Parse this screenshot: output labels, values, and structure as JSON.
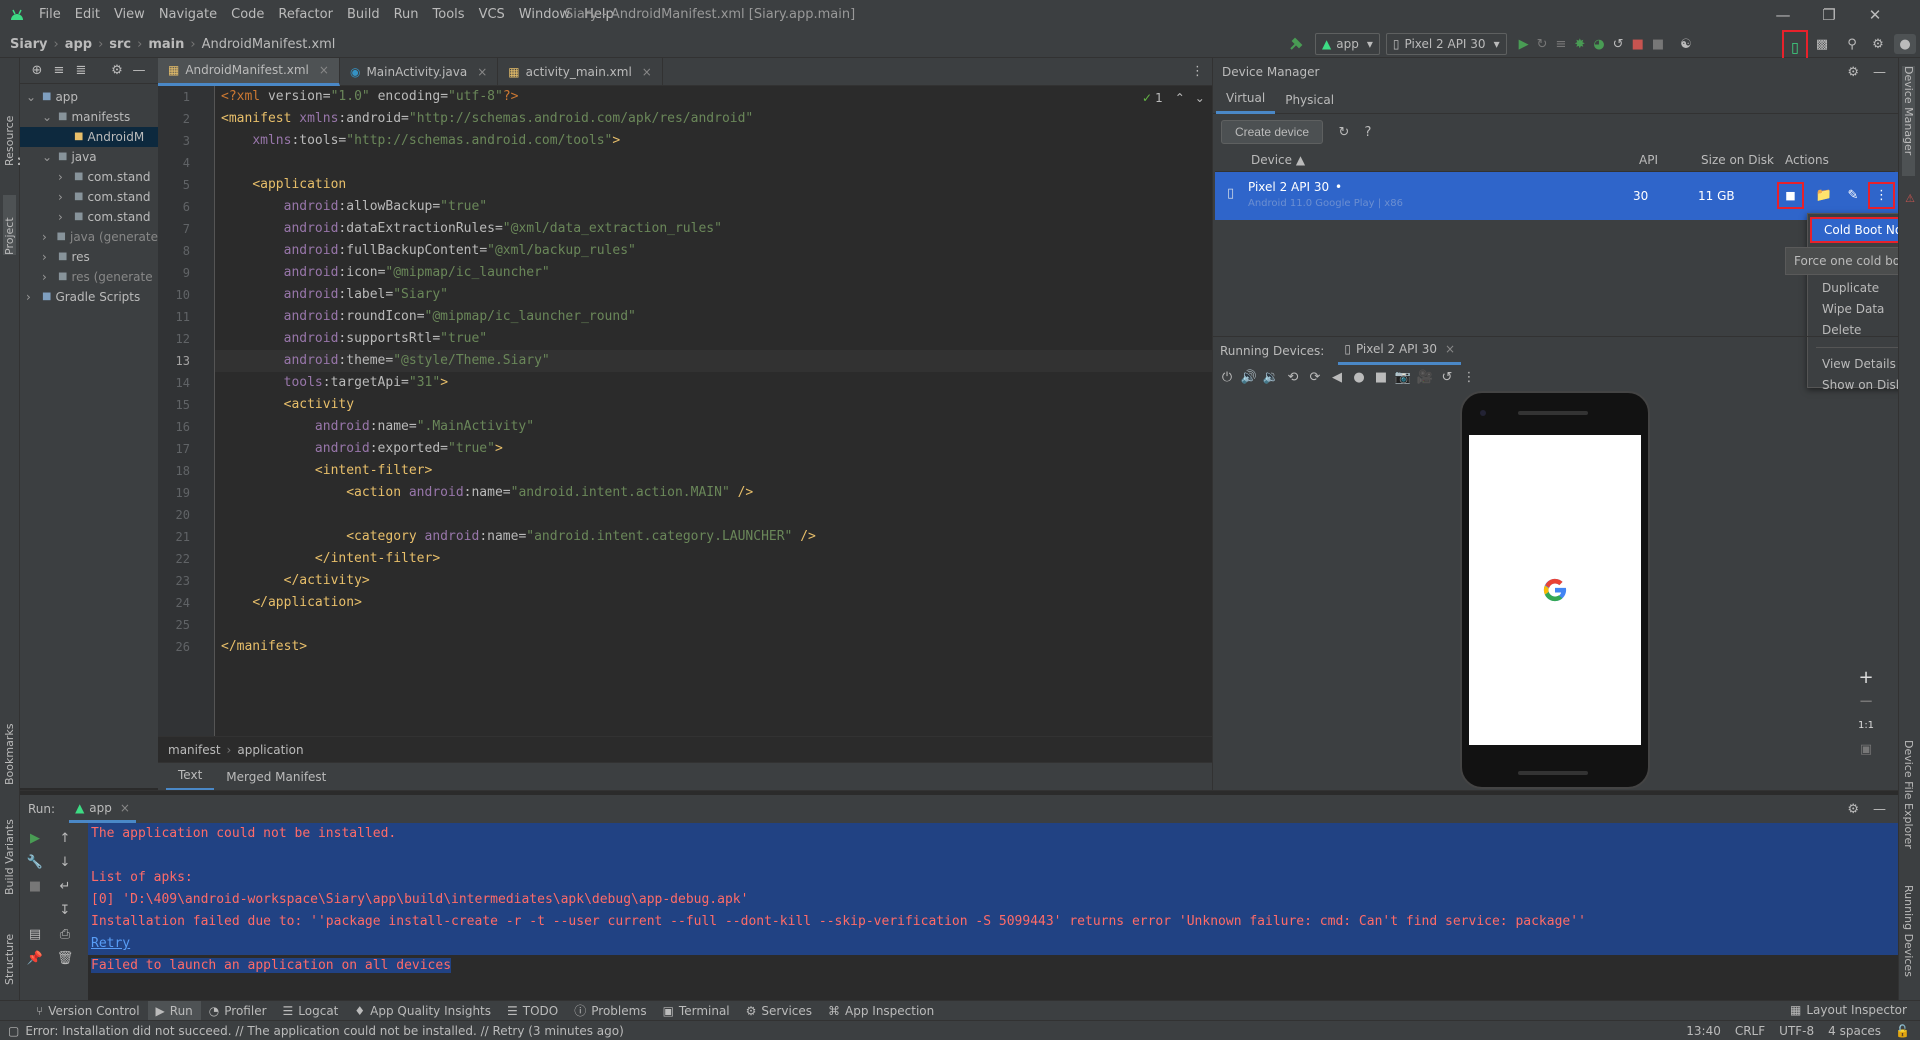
{
  "window": {
    "title": "Siary - AndroidManifest.xml [Siary.app.main]",
    "menu": [
      "File",
      "Edit",
      "View",
      "Navigate",
      "Code",
      "Refactor",
      "Build",
      "Run",
      "Tools",
      "VCS",
      "Window",
      "Help"
    ]
  },
  "breadcrumbs": [
    "Siary",
    "app",
    "src",
    "main",
    "AndroidManifest.xml"
  ],
  "toolbar": {
    "run_config": "app",
    "device": "Pixel 2 API 30"
  },
  "left_stripe": [
    "Resource Manager",
    "Project",
    "Bookmarks",
    "Build Variants",
    "Structure"
  ],
  "right_stripe": [
    "Device Manager",
    "Device File Explorer",
    "Running Devices"
  ],
  "project_tree": [
    {
      "label": "app",
      "level": 0
    },
    {
      "label": "manifests",
      "level": 1
    },
    {
      "label": "AndroidM",
      "level": 2
    },
    {
      "label": "java",
      "level": 1
    },
    {
      "label": "com.stand",
      "level": 2
    },
    {
      "label": "com.stand",
      "level": 2
    },
    {
      "label": "com.stand",
      "level": 2
    },
    {
      "label": "java (generate",
      "level": 1
    },
    {
      "label": "res",
      "level": 1
    },
    {
      "label": "res (generate",
      "level": 1
    },
    {
      "label": "Gradle Scripts",
      "level": 0
    }
  ],
  "editor_tabs": [
    "AndroidManifest.xml",
    "MainActivity.java",
    "activity_main.xml"
  ],
  "editor": {
    "inspection_count": "1",
    "current_line": 13,
    "lines": [
      "<?xml version=\"1.0\" encoding=\"utf-8\"?>",
      "<manifest xmlns:android=\"http://schemas.android.com/apk/res/android\"",
      "    xmlns:tools=\"http://schemas.android.com/tools\">",
      "",
      "    <application",
      "        android:allowBackup=\"true\"",
      "        android:dataExtractionRules=\"@xml/data_extraction_rules\"",
      "        android:fullBackupContent=\"@xml/backup_rules\"",
      "        android:icon=\"@mipmap/ic_launcher\"",
      "        android:label=\"Siary\"",
      "        android:roundIcon=\"@mipmap/ic_launcher_round\"",
      "        android:supportsRtl=\"true\"",
      "        android:theme=\"@style/Theme.Siary\"",
      "        tools:targetApi=\"31\">",
      "        <activity",
      "            android:name=\".MainActivity\"",
      "            android:exported=\"true\">",
      "            <intent-filter>",
      "                <action android:name=\"android.intent.action.MAIN\" />",
      "",
      "                <category android:name=\"android.intent.category.LAUNCHER\" />",
      "            </intent-filter>",
      "        </activity>",
      "    </application>",
      "",
      "</manifest>"
    ]
  },
  "editor_breadcrumb": [
    "manifest",
    "application"
  ],
  "manifest_tabs": [
    "Text",
    "Merged Manifest"
  ],
  "device_manager": {
    "title": "Device Manager",
    "tabs": [
      "Virtual",
      "Physical"
    ],
    "create_label": "Create device",
    "columns": [
      "Device",
      "API",
      "Size on Disk",
      "Actions"
    ],
    "device": {
      "name": "Pixel 2 API 30",
      "subtitle": "Android 11.0 Google Play | x86",
      "api": "30",
      "size": "11 GB"
    },
    "menu": [
      "Cold Boot Now",
      "Duplicate",
      "Wipe Data",
      "Delete",
      "View Details",
      "Show on Disk"
    ],
    "tooltip": "Force one cold boot"
  },
  "running_devices": {
    "label": "Running Devices:",
    "tab": "Pixel 2 API 30",
    "zoom": "1:1"
  },
  "run": {
    "label": "Run:",
    "tab": "app",
    "lines": [
      {
        "text": "The application could not be installed.",
        "kind": "err"
      },
      {
        "text": "",
        "kind": "err"
      },
      {
        "text": "List of apks:",
        "kind": "err"
      },
      {
        "text": "[0] 'D:\\409\\android-workspace\\Siary\\app\\build\\intermediates\\apk\\debug\\app-debug.apk'",
        "kind": "err"
      },
      {
        "text": "Installation failed due to: ''package install-create -r -t --user current --full --dont-kill --skip-verification -S 5099443' returns error 'Unknown failure: cmd: Can't find service: package''",
        "kind": "err"
      },
      {
        "text": "Retry",
        "kind": "link"
      },
      {
        "text": "Failed to launch an application on all devices",
        "kind": "err"
      }
    ]
  },
  "bottom_tools": [
    "Version Control",
    "Run",
    "Profiler",
    "Logcat",
    "App Quality Insights",
    "TODO",
    "Problems",
    "Terminal",
    "Services",
    "App Inspection"
  ],
  "layout_inspector": "Layout Inspector",
  "status": {
    "message": "Error: Installation did not succeed. // The application could not be installed. // Retry (3 minutes ago)",
    "position": "13:40",
    "line_sep": "CRLF",
    "encoding": "UTF-8",
    "indent": "4 spaces"
  },
  "colors": {
    "accent": "#2f65ca",
    "error": "#ff6b68",
    "highlight_box": "#e8212b",
    "selection": "#214283"
  }
}
